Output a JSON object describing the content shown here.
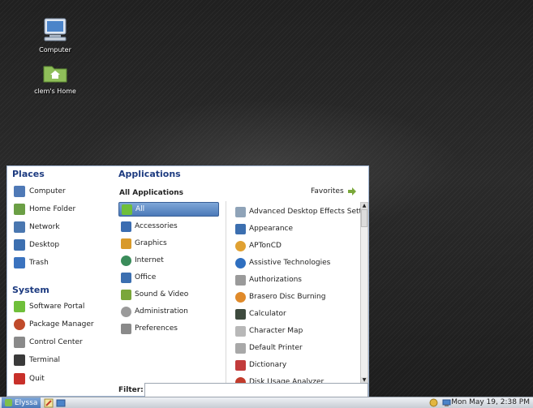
{
  "desktop": {
    "icons": [
      {
        "label": "Computer",
        "icon": "computer-icon"
      },
      {
        "label": "clem's Home",
        "icon": "home-folder-icon"
      }
    ]
  },
  "menu": {
    "places": {
      "title": "Places",
      "items": [
        {
          "label": "Computer",
          "icon": "computer-icon",
          "color": "#4f79b6"
        },
        {
          "label": "Home Folder",
          "icon": "home-folder-icon",
          "color": "#6b9f45"
        },
        {
          "label": "Network",
          "icon": "network-icon",
          "color": "#4a77b0"
        },
        {
          "label": "Desktop",
          "icon": "desktop-icon",
          "color": "#3c6fb0"
        },
        {
          "label": "Trash",
          "icon": "trash-icon",
          "color": "#3b73bf"
        }
      ]
    },
    "system": {
      "title": "System",
      "items": [
        {
          "label": "Software Portal",
          "icon": "software-portal-icon",
          "color": "#6fbf3a"
        },
        {
          "label": "Package Manager",
          "icon": "package-manager-icon",
          "color": "#c04b2b"
        },
        {
          "label": "Control Center",
          "icon": "control-center-icon",
          "color": "#8a8a8a"
        },
        {
          "label": "Terminal",
          "icon": "terminal-icon",
          "color": "#3a3a3a"
        },
        {
          "label": "Quit",
          "icon": "quit-icon",
          "color": "#c8302a"
        }
      ]
    },
    "applications": {
      "title": "Applications",
      "subtitle": "All Applications",
      "favorites_label": "Favorites",
      "categories": [
        {
          "label": "All",
          "icon": "all-icon",
          "selected": true,
          "color": "#6fbf3a"
        },
        {
          "label": "Accessories",
          "icon": "accessories-icon",
          "color": "#3b6db1"
        },
        {
          "label": "Graphics",
          "icon": "graphics-icon",
          "color": "#d89a2a"
        },
        {
          "label": "Internet",
          "icon": "internet-icon",
          "color": "#3a8c5a"
        },
        {
          "label": "Office",
          "icon": "office-icon",
          "color": "#3c6fb0"
        },
        {
          "label": "Sound & Video",
          "icon": "sound-video-icon",
          "color": "#7aa63a"
        },
        {
          "label": "Administration",
          "icon": "administration-icon",
          "color": "#9a9a9a"
        },
        {
          "label": "Preferences",
          "icon": "preferences-icon",
          "color": "#8a8a8a"
        }
      ],
      "apps": [
        {
          "label": "Advanced Desktop Effects Setti...",
          "icon": "desktop-effects-icon",
          "color": "#8fa3b8"
        },
        {
          "label": "Appearance",
          "icon": "appearance-icon",
          "color": "#3c6fb0"
        },
        {
          "label": "APTonCD",
          "icon": "aptoncd-icon",
          "color": "#e0a132"
        },
        {
          "label": "Assistive Technologies",
          "icon": "accessibility-icon",
          "color": "#2f6fc0"
        },
        {
          "label": "Authorizations",
          "icon": "authorizations-icon",
          "color": "#9a9a9a"
        },
        {
          "label": "Brasero Disc Burning",
          "icon": "brasero-icon",
          "color": "#e08a2a"
        },
        {
          "label": "Calculator",
          "icon": "calculator-icon",
          "color": "#3e4a3e"
        },
        {
          "label": "Character Map",
          "icon": "character-map-icon",
          "color": "#b8b8b8"
        },
        {
          "label": "Default Printer",
          "icon": "printer-icon",
          "color": "#a8a8a8"
        },
        {
          "label": "Dictionary",
          "icon": "dictionary-icon",
          "color": "#c23b3b"
        },
        {
          "label": "Disk Usage Analyzer",
          "icon": "disk-usage-icon",
          "color": "#c23b2b"
        }
      ]
    },
    "filter": {
      "label": "Filter:",
      "value": ""
    }
  },
  "taskbar": {
    "menu_label": "Elyssa",
    "clock": "Mon May 19,  2:38 PM"
  }
}
